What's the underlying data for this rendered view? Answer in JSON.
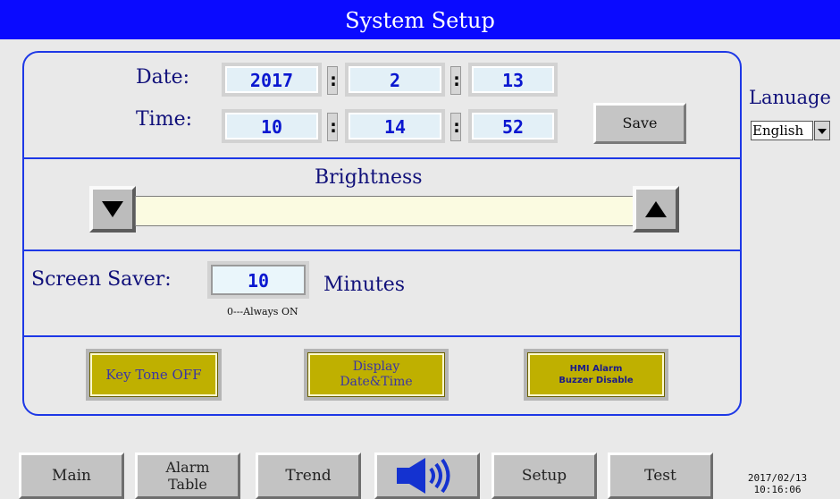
{
  "title": "System Setup",
  "datetime_setup": {
    "date_label": "Date:",
    "time_label": "Time:",
    "date": {
      "year": "2017",
      "month": "2",
      "day": "13"
    },
    "time": {
      "hour": "10",
      "minute": "14",
      "second": "52"
    },
    "separator": ":",
    "save_label": "Save"
  },
  "language": {
    "label": "Lanuage",
    "selected": "English"
  },
  "brightness": {
    "label": "Brightness"
  },
  "screen_saver": {
    "label": "Screen Saver:",
    "value": "10",
    "unit": "Minutes",
    "hint": "0---Always ON"
  },
  "toggles": {
    "key_tone": "Key Tone OFF",
    "display_datetime_line1": "Display",
    "display_datetime_line2": "Date&Time",
    "hmi_alarm_line1": "HMI Alarm",
    "hmi_alarm_line2": "Buzzer Disable"
  },
  "nav": {
    "main": "Main",
    "alarm_table_line1": "Alarm",
    "alarm_table_line2": "Table",
    "trend": "Trend",
    "sound_icon": "speaker-volume-icon",
    "setup": "Setup",
    "test": "Test"
  },
  "clock": {
    "date": "2017/02/13",
    "time": "10:16:06"
  },
  "colors": {
    "title_bar": "#0a0aff",
    "panel_border": "#1d38e6",
    "toggle_active": "#bfb000",
    "background": "#e9e9e9"
  }
}
